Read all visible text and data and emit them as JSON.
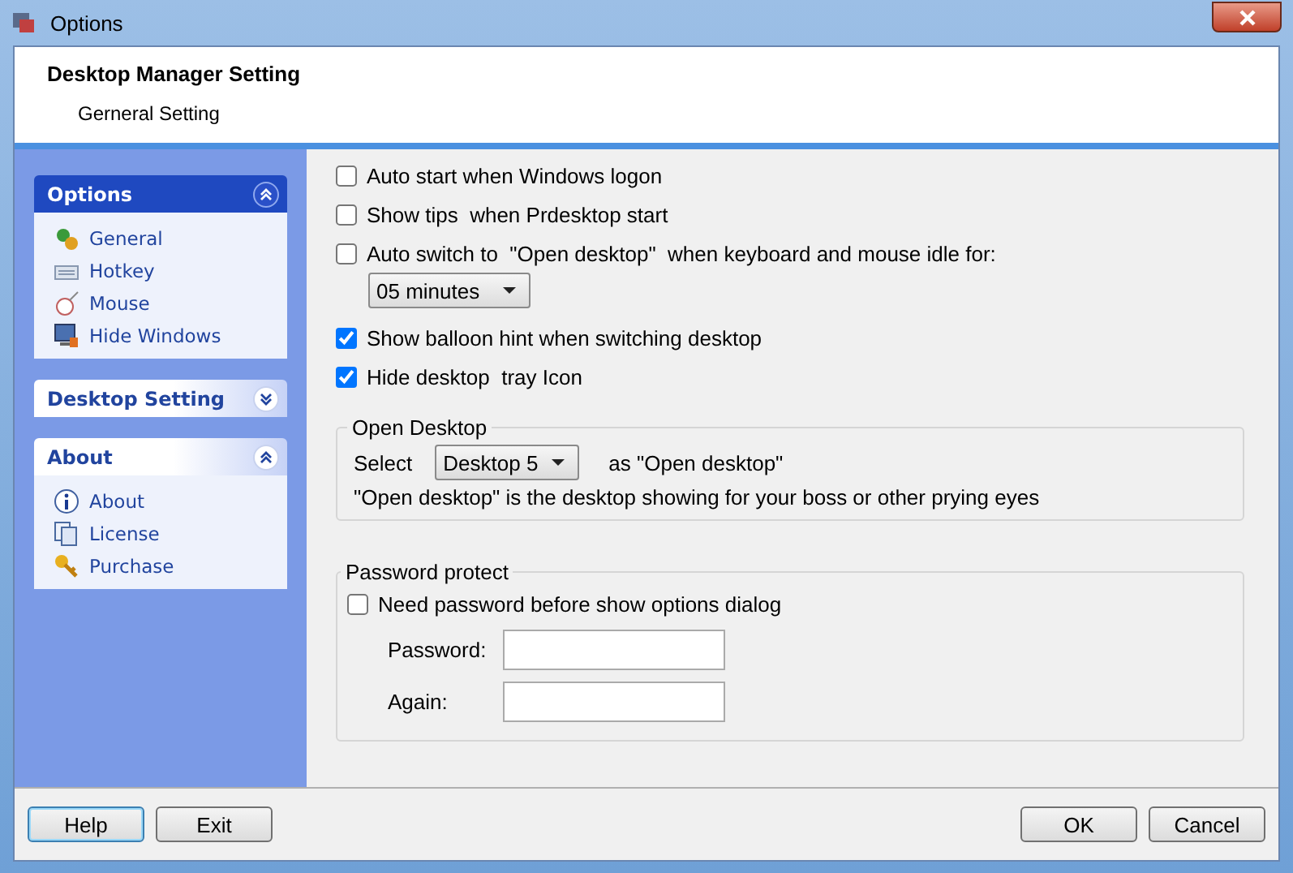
{
  "window": {
    "title": "Options"
  },
  "header": {
    "title": "Desktop Manager Setting",
    "subtitle": "Gerneral Setting"
  },
  "sidebar": {
    "groups": [
      {
        "title": "Options",
        "expanded": true,
        "items": [
          {
            "label": "General",
            "kind": "general"
          },
          {
            "label": "Hotkey",
            "kind": "keyboard"
          },
          {
            "label": "Mouse",
            "kind": "mouse"
          },
          {
            "label": "Hide Windows",
            "kind": "monitor"
          }
        ]
      },
      {
        "title": "Desktop Setting",
        "expanded": false
      },
      {
        "title": "About",
        "expanded": true,
        "items": [
          {
            "label": "About",
            "kind": "info"
          },
          {
            "label": "License",
            "kind": "document"
          },
          {
            "label": "Purchase",
            "kind": "key"
          }
        ]
      }
    ]
  },
  "options": [
    {
      "label": "Auto start when Windows logon",
      "checked": false
    },
    {
      "label": "Show tips  when Prdesktop start",
      "checked": false
    },
    {
      "label": "Auto switch to  \"Open desktop\"  when keyboard and mouse idle for:",
      "checked": false,
      "dropdown": "05 minutes"
    },
    {
      "label": "Show balloon hint when switching desktop",
      "checked": true
    },
    {
      "label": "Hide desktop  tray Icon",
      "checked": true
    }
  ],
  "open_desktop": {
    "title": "Open Desktop",
    "select_label": "Select",
    "dropdown": "Desktop 5",
    "suffix": "as \"Open desktop\"",
    "note": "\"Open desktop\" is the desktop showing for your boss or other prying eyes"
  },
  "password": {
    "title": "Password protect",
    "checkbox": {
      "label": "Need password before show options dialog",
      "checked": false
    },
    "fields": [
      {
        "label": "Password:"
      },
      {
        "label": "Again:"
      }
    ]
  },
  "buttons_left": [
    {
      "label": "Help",
      "focused": true
    },
    {
      "label": "Exit",
      "focused": false
    }
  ],
  "buttons_right": [
    {
      "label": "OK",
      "focused": false
    },
    {
      "label": "Cancel",
      "focused": false
    }
  ]
}
